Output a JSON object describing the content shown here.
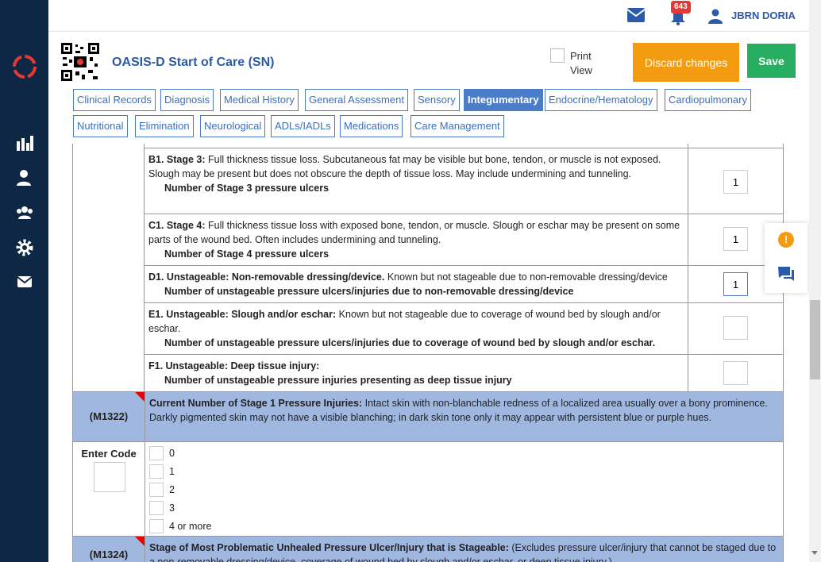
{
  "header": {
    "notification_count": "643",
    "user_name": "JBRN DORIA",
    "form_title": "OASIS-D Start of Care (SN)",
    "print_label": "Print View",
    "discard_label": "Discard changes",
    "save_label": "Save"
  },
  "tabs": [
    "Clinical Records",
    "Diagnosis",
    "Medical History",
    "General Assessment",
    "Sensory",
    "Integumentary",
    "Endocrine/Hematology",
    "Cardiopulmonary",
    "Nutritional",
    "Elimination",
    "Neurological",
    "ADLs/IADLs",
    "Medications",
    "Care Management"
  ],
  "active_tab": "Integumentary",
  "stages": {
    "b1": {
      "label": "B1. Stage 3:",
      "text": "Full thickness tissue loss. Subcutaneous fat may be visible but bone, tendon, or muscle is not exposed. Slough may be present but does not obscure the depth of tissue loss. May include undermining and tunneling.",
      "sub": "Number of Stage 3 pressure ulcers",
      "value": "1"
    },
    "c1": {
      "label": "C1. Stage 4:",
      "text": "Full thickness tissue loss with exposed bone, tendon, or muscle. Slough or eschar may be present on some parts of the wound bed. Often includes undermining and tunneling.",
      "sub": "Number of Stage 4 pressure ulcers",
      "value": "1"
    },
    "d1": {
      "label": "D1. Unstageable: Non-removable dressing/device.",
      "text": "Known but not stageable due to non-removable dressing/device",
      "sub": "Number of unstageable pressure ulcers/injuries due to non-removable dressing/device",
      "value": "1"
    },
    "e1": {
      "label": "E1. Unstageable: Slough and/or eschar:",
      "text": "Known but not stageable due to coverage of wound bed by slough and/or eschar.",
      "sub": "Number of unstageable pressure ulcers/injuries due to coverage of wound bed by slough and/or eschar.",
      "value": ""
    },
    "f1": {
      "label": "F1. Unstageable: Deep tissue injury:",
      "text": "",
      "sub": "Number of unstageable pressure injuries presenting as deep tissue injury",
      "value": ""
    }
  },
  "m1322": {
    "code": "(M1322)",
    "title": "Current Number of Stage 1 Pressure Injuries:",
    "text": "Intact skin with non-blanchable redness of a localized area usually over a bony prominence. Darkly pigmented skin may not have a visible blanching; in dark skin tone only it may appear with persistent blue or purple hues.",
    "enter_code_label": "Enter Code",
    "options": [
      "0",
      "1",
      "2",
      "3",
      "4 or more"
    ]
  },
  "m1324": {
    "code": "(M1324)",
    "title": "Stage of Most Problematic Unhealed Pressure Ulcer/Injury that is Stageable:",
    "text": "(Excludes pressure ulcer/injury that cannot be staged due to a non-removable dressing/device, coverage of wound bed by slough and/or eschar, or deep tissue injury.)"
  },
  "colors": {
    "nav_bg": "#0e2744",
    "accent": "#2b5aa8",
    "discard": "#f39c12",
    "save": "#27ae60",
    "section_bg": "#a0b8e0"
  },
  "icons": [
    "logo-icon",
    "chart-icon",
    "user-icon",
    "group-icon",
    "gear-icon",
    "mail-icon",
    "bell-icon",
    "alert-icon",
    "chat-icon",
    "qr-code"
  ]
}
